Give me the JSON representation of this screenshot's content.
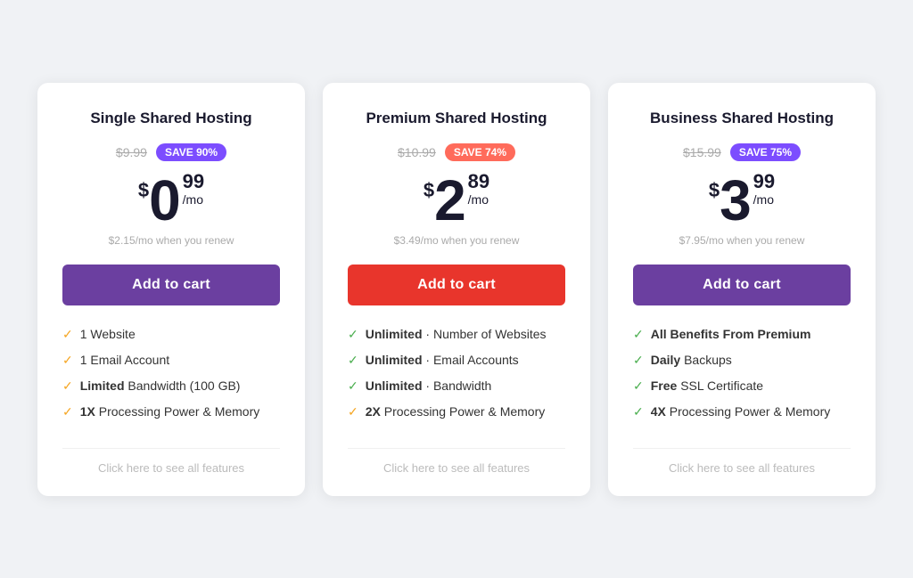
{
  "plans": [
    {
      "id": "single",
      "title": "Single Shared Hosting",
      "original_price": "$9.99",
      "save_label": "SAVE 90%",
      "save_color": "purple",
      "currency": "$",
      "amount": "0",
      "cents": "99",
      "per_mo": "/mo",
      "renew_text": "$2.15/mo when you renew",
      "button_label": "Add to cart",
      "button_class": "btn-purple",
      "features": [
        {
          "bold": "",
          "text": "1 Website",
          "check_color": "yellow"
        },
        {
          "bold": "",
          "text": "1 Email Account",
          "check_color": "yellow"
        },
        {
          "bold": "Limited",
          "text": " Bandwidth (100 GB)",
          "check_color": "yellow"
        },
        {
          "bold": "1X",
          "text": " Processing Power & Memory",
          "check_color": "yellow"
        }
      ],
      "see_all_label": "Click here to see all features"
    },
    {
      "id": "premium",
      "title": "Premium Shared Hosting",
      "original_price": "$10.99",
      "save_label": "SAVE 74%",
      "save_color": "coral",
      "currency": "$",
      "amount": "2",
      "cents": "89",
      "per_mo": "/mo",
      "renew_text": "$3.49/mo when you renew",
      "button_label": "Add to cart",
      "button_class": "btn-red",
      "features": [
        {
          "bold": "Unlimited",
          "text": " · Number of Websites",
          "check_color": "green"
        },
        {
          "bold": "Unlimited",
          "text": " · Email Accounts",
          "check_color": "green"
        },
        {
          "bold": "Unlimited",
          "text": " · Bandwidth",
          "check_color": "green"
        },
        {
          "bold": "2X",
          "text": " Processing Power & Memory",
          "check_color": "yellow"
        }
      ],
      "see_all_label": "Click here to see all features"
    },
    {
      "id": "business",
      "title": "Business Shared Hosting",
      "original_price": "$15.99",
      "save_label": "SAVE 75%",
      "save_color": "purple",
      "currency": "$",
      "amount": "3",
      "cents": "99",
      "per_mo": "/mo",
      "renew_text": "$7.95/mo when you renew",
      "button_label": "Add to cart",
      "button_class": "btn-purple",
      "features": [
        {
          "bold": "All Benefits From Premium",
          "text": "",
          "check_color": "green"
        },
        {
          "bold": "Daily",
          "text": " Backups",
          "check_color": "green"
        },
        {
          "bold": "Free",
          "text": " SSL Certificate",
          "check_color": "green"
        },
        {
          "bold": "4X",
          "text": " Processing Power & Memory",
          "check_color": "green"
        }
      ],
      "see_all_label": "Click here to see all features"
    }
  ]
}
